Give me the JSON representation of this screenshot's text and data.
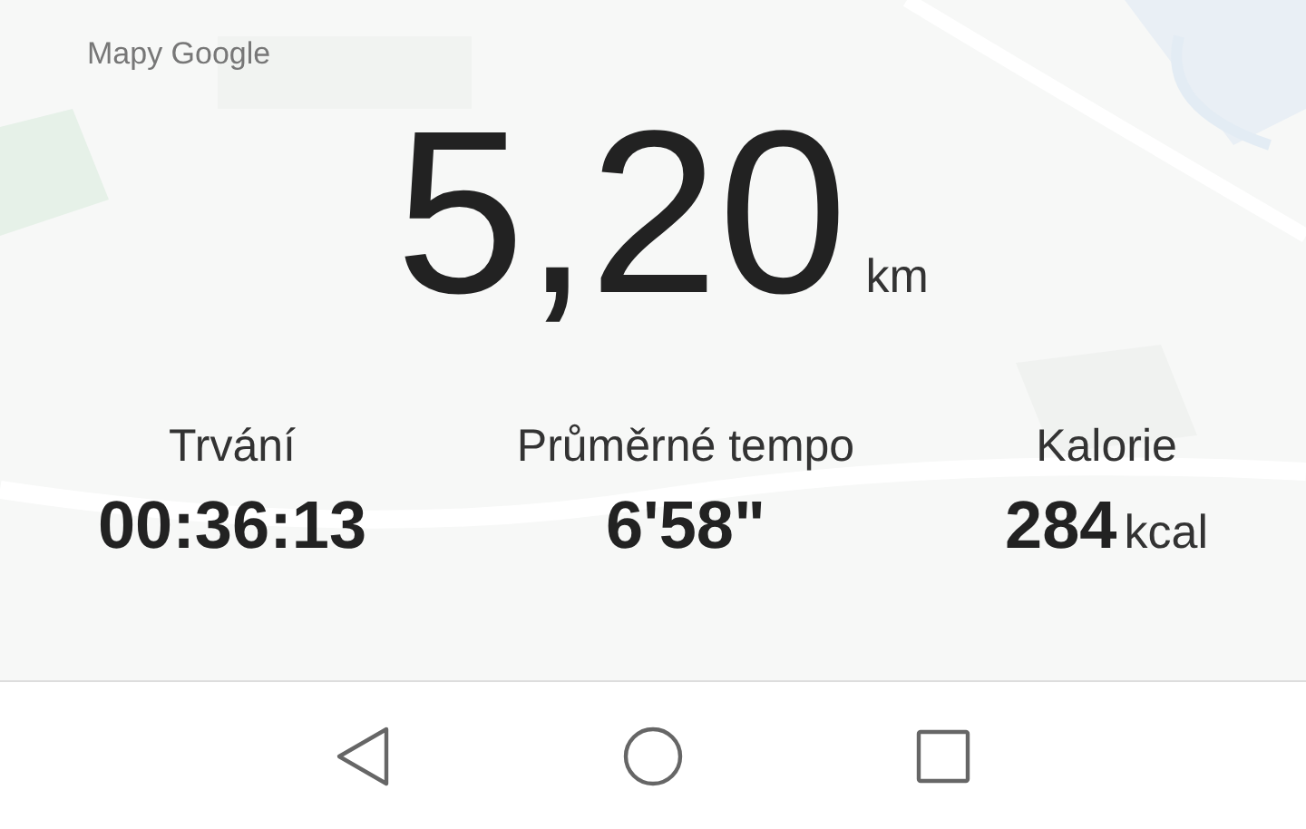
{
  "map": {
    "kind": "picture",
    "attribution": "Mapy Google"
  },
  "distance": {
    "value": "5,20",
    "unit": "km"
  },
  "stats": [
    {
      "label": "Trvání",
      "value": "00:36:13"
    },
    {
      "label": "Průměrné tempo",
      "value": "6'58\""
    },
    {
      "label": "Kalorie",
      "value": "284",
      "unit": "kcal"
    }
  ],
  "nav": [
    {
      "kind": "back"
    },
    {
      "kind": "home"
    },
    {
      "kind": "recents"
    }
  ]
}
